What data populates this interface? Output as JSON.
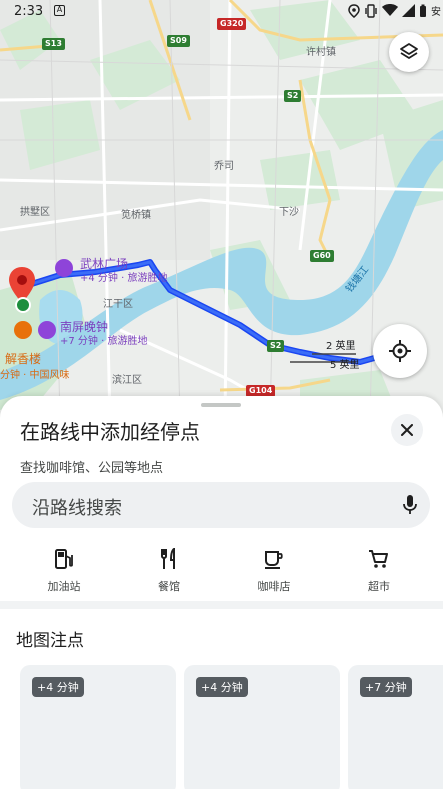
{
  "status_bar": {
    "time": "2:33",
    "carrier_text": "安"
  },
  "map": {
    "shields": {
      "g320": "G320",
      "s13": "S13",
      "s09": "S09",
      "s2a": "S2",
      "g60": "G60",
      "s2b": "S2",
      "g104": "G104"
    },
    "places": {
      "xulinzhen": "许村镇",
      "qiaosi": "乔司",
      "gongshu": "拱墅区",
      "jianqiao": "笕桥镇",
      "xiasha": "下沙",
      "jianggan": "江干区",
      "binjiang": "滨江区",
      "river": "钱塘江"
    },
    "poi_wulin": {
      "name": "武林广场",
      "sub": "+4 分钟 · 旅游胜地"
    },
    "poi_nanping": {
      "name": "南屏晚钟",
      "sub": "+7 分钟 · 旅游胜地"
    },
    "poi_jiexiang": {
      "name": "解香楼",
      "sub": "分钟 · 中国风味"
    },
    "distance_1": "2 英里",
    "distance_2": "5 英里"
  },
  "sheet": {
    "title": "在路线中添加经停点",
    "subtitle": "查找咖啡馆、公园等地点",
    "search_placeholder": "沿路线搜索",
    "categories": [
      {
        "label": "加油站",
        "icon": "gas-station-icon"
      },
      {
        "label": "餐馆",
        "icon": "restaurant-icon"
      },
      {
        "label": "咖啡店",
        "icon": "coffee-icon"
      },
      {
        "label": "超市",
        "icon": "shopping-cart-icon"
      }
    ],
    "section_title": "地图注点",
    "cards": [
      {
        "badge": "+4 分钟"
      },
      {
        "badge": "+4 分钟"
      },
      {
        "badge": "+7 分钟"
      }
    ]
  }
}
